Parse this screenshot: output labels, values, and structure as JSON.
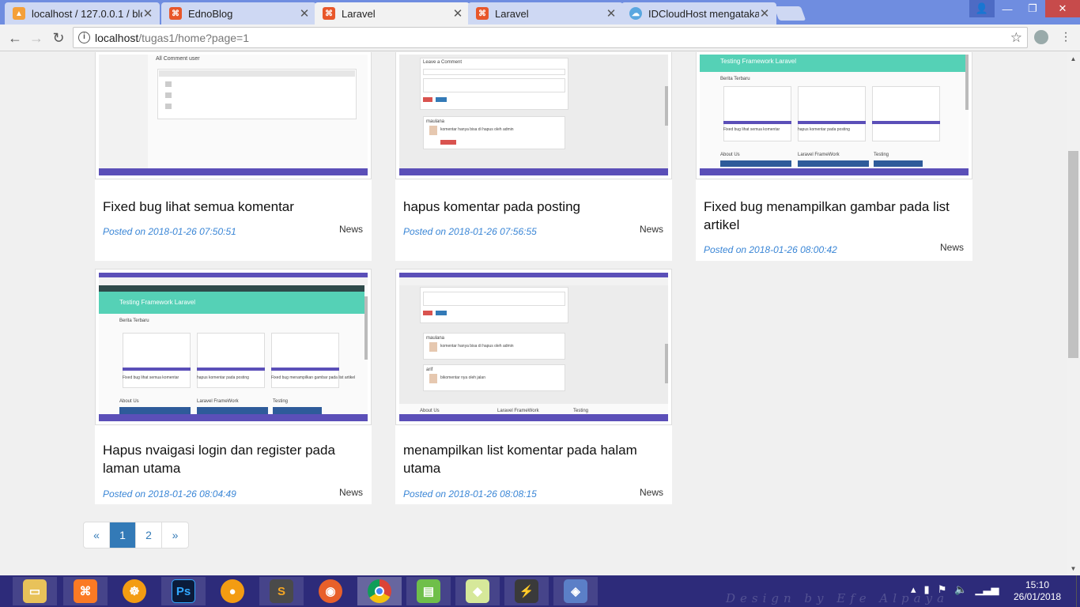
{
  "browser": {
    "tabs": [
      {
        "label": "localhost / 127.0.0.1 / blo",
        "icon": "phpmyadmin-icon",
        "active": false
      },
      {
        "label": "EdnoBlog",
        "icon": "laravel-icon",
        "active": false
      },
      {
        "label": "Laravel",
        "icon": "laravel-icon",
        "active": true
      },
      {
        "label": "Laravel",
        "icon": "laravel-icon",
        "active": false
      },
      {
        "label": "IDCloudHost mengatakar",
        "icon": "cloud-icon",
        "active": false
      }
    ],
    "url_host": "localhost",
    "url_path": "/tugas1/home?page=1"
  },
  "posts": [
    {
      "title": "Fixed bug lihat semua komentar",
      "posted": "Posted on 2018-01-26 07:50:51",
      "category": "News"
    },
    {
      "title": "hapus komentar pada posting",
      "posted": "Posted on 2018-01-26 07:56:55",
      "category": "News"
    },
    {
      "title": "Fixed bug menampilkan gambar pada list artikel",
      "posted": "Posted on 2018-01-26 08:00:42",
      "category": "News"
    },
    {
      "title": "Hapus nvaigasi login dan register pada laman utama",
      "posted": "Posted on 2018-01-26 08:04:49",
      "category": "News"
    },
    {
      "title": "menampilkan list komentar pada halam utama",
      "posted": "Posted on 2018-01-26 08:08:15",
      "category": "News"
    }
  ],
  "thumb_text": {
    "all_comment": "All Comment user",
    "leave_comment": "Leave a Comment",
    "maulana": "maulana",
    "komentar": "komentar hanya bisa di hapus oleh admin",
    "hapus": "Hapus",
    "testing": "Testing Framework Laravel",
    "berita": "Berita Terbaru",
    "about": "About Us",
    "laravel_fw": "Laravel FrameWork",
    "testing_short": "Testing",
    "fixed_mini": "Fixed bug lihat semua komentar",
    "hapus_mini": "hapus komentar pada posting",
    "gambar_mini": "Fixed bug menampilkan gambar pada list artikel",
    "arif": "arif",
    "arif_komentar": "bikomentar nya oleh jalan"
  },
  "pagination": {
    "prev": "«",
    "pages": [
      "1",
      "2"
    ],
    "next": "»",
    "current": "1"
  },
  "taskbar": {
    "time": "15:10",
    "date": "26/01/2018",
    "watermark": "Design by Efe Alpaya",
    "photoshop": "Ps",
    "accent": "#2d2b7a"
  }
}
